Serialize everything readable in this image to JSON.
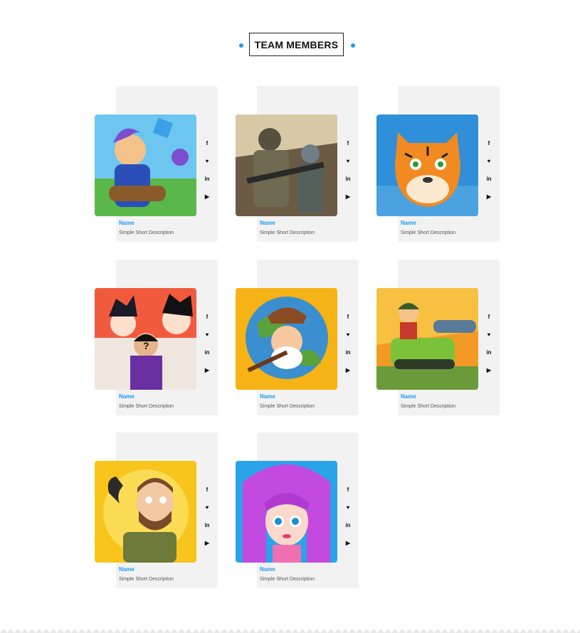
{
  "section": {
    "title": "TEAM MEMBERS"
  },
  "social_icons": [
    "facebook-icon",
    "twitter-icon",
    "linkedin-icon",
    "youtube-icon"
  ],
  "social_glyphs": [
    "f",
    "♥",
    "in",
    "▶"
  ],
  "members": [
    {
      "name": "Name",
      "description": "Simple Short Description",
      "art": "hero-bazooka"
    },
    {
      "name": "Name",
      "description": "Simple Short Description",
      "art": "soldiers"
    },
    {
      "name": "Name",
      "description": "Simple Short Description",
      "art": "tiger"
    },
    {
      "name": "Name",
      "description": "Simple Short Description",
      "art": "anime-guess"
    },
    {
      "name": "Name",
      "description": "Simple Short Description",
      "art": "miner-planet"
    },
    {
      "name": "Name",
      "description": "Simple Short Description",
      "art": "tank-kid"
    },
    {
      "name": "Name",
      "description": "Simple Short Description",
      "art": "phone-guy"
    },
    {
      "name": "Name",
      "description": "Simple Short Description",
      "art": "purple-girl"
    }
  ],
  "colors": {
    "accent": "#1e9bf0",
    "panel": "#f2f2f2"
  }
}
